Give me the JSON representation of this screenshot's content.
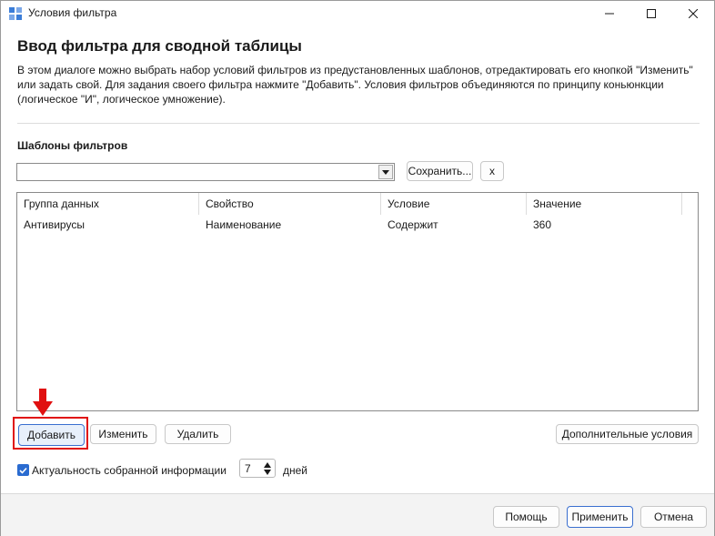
{
  "window": {
    "title": "Условия фильтра",
    "app_icon": "filter-app-icon",
    "controls": {
      "minimize": "minimize-icon",
      "maximize": "maximize-icon",
      "close": "close-icon"
    }
  },
  "heading": "Ввод фильтра для сводной таблицы",
  "description": "В этом диалоге можно выбрать набор условий фильтров из предустановленных шаблонов, отредактировать его кнопкой \"Изменить\" или задать свой. Для задания своего фильтра нажмите \"Добавить\". Условия фильтров объединяются по принципу коньюнкции (логическое \"И\", логическое умножение).",
  "templates": {
    "label": "Шаблоны фильтров",
    "selected": "",
    "save_label": "Сохранить...",
    "delete_label": "x"
  },
  "grid": {
    "columns": [
      "Группа данных",
      "Свойство",
      "Условие",
      "Значение"
    ],
    "rows": [
      [
        "Антивирусы",
        "Наименование",
        "Содержит",
        "360"
      ]
    ]
  },
  "actions": {
    "add": "Добавить",
    "edit": "Изменить",
    "delete": "Удалить",
    "more_conditions": "Дополнительные условия"
  },
  "freshness": {
    "checked": true,
    "label": "Актуальность собранной информации",
    "value": "7",
    "unit": "дней"
  },
  "footer": {
    "help": "Помощь",
    "apply": "Применить",
    "cancel": "Отмена"
  },
  "colors": {
    "accent": "#2a6bd0",
    "highlight": "#e01010"
  }
}
